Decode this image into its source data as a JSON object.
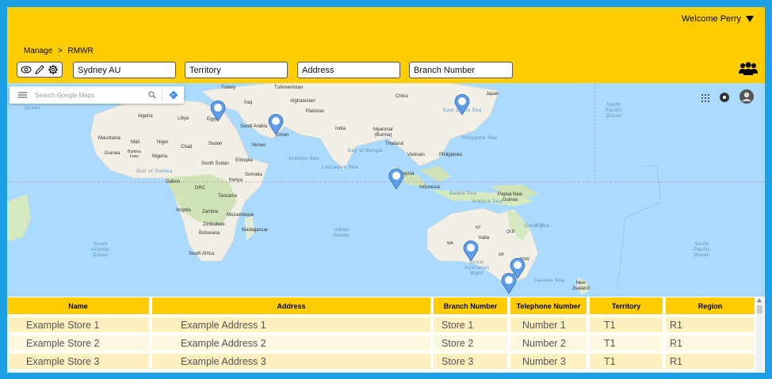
{
  "header": {
    "welcome": "Welcome Perry",
    "breadcrumb": {
      "root": "Manage",
      "sep": ">",
      "current": "RMWR"
    },
    "fields": {
      "location": "Sydney AU",
      "territory": "Territory",
      "address": "Address",
      "branch_number": "Branch Number"
    },
    "tools": [
      "eye-icon",
      "pencil-icon",
      "gear-icon"
    ],
    "right_icon": "people-group-icon",
    "accent": "#ffcc00"
  },
  "map": {
    "search_placeholder": "Search Google Maps",
    "labels": {
      "turkey": "Turkey",
      "turkmenistan": "Turkmenistan",
      "iraq": "Iraq",
      "afghanistan": "Afghanistan",
      "libya": "Libya",
      "algeria": "Algeria",
      "egypt": "Egypt",
      "pakistan": "Pakistan",
      "china": "China",
      "japan": "Japan",
      "saudi_arabia": "Saudi Arabia",
      "oman": "Oman",
      "india": "India",
      "myanmar": "Myanmar\n(Burma)",
      "thailand": "Thailand",
      "mauritania": "Mauritania",
      "mali": "Mali",
      "niger": "Niger",
      "chad": "Chad",
      "sudan": "Sudan",
      "yemen": "Yemen",
      "burkina": "Burkina\nFaso",
      "guinea": "Guinea",
      "nigeria": "Nigeria",
      "south_sudan": "South Sudan",
      "ethiopia": "Ethiopia",
      "somalia": "Somalia",
      "kenya": "Kenya",
      "gabon": "Gabon",
      "drc": "DRC",
      "tanzania": "Tanzania",
      "angola": "Angola",
      "zambia": "Zambia",
      "mozambique": "Mozambique",
      "zimbabwe": "Zimbabwe",
      "botswana": "Botswana",
      "madagascar": "Madagascar",
      "south_africa": "South Africa",
      "vietnam": "Vietnam",
      "philippines": "Philippines",
      "malaysia": "laysia",
      "indonesia": "Indonesia",
      "papua": "Papua New\nGuinea",
      "australia": "tralia",
      "new_zealand": "New\nZealand",
      "arabian_sea": "Arabian Sea",
      "bay_of_bengal": "Bay of Bengal",
      "east_china_sea": "East China Sea",
      "philippine_sea": "Philippine Sea",
      "laccadive_sea": "Laccadive Sea",
      "gulf_of_guinea": "Gulf of Guinea",
      "banda_sea": "Banda Sea",
      "arafura_sea": "Arafura Sea",
      "coral_sea": "Coral Sea",
      "fiji": "Fiji",
      "tasman_sea": "Tasman Sea",
      "great_bight": "Great\nAustralian\nBight",
      "ocean_n_pacific": "North\nPacific\nOcean",
      "ocean_s_pacific": "South\nPacific\nOcean",
      "ocean_indian": "Indian\nOcean",
      "ocean_s_atlantic": "South\nAtlantic\nOcean",
      "wa": "WA",
      "nt": "NT",
      "qld": "QLD",
      "nsw": "NSW",
      "vic": "VIC",
      "sa": "SA",
      "ocean": "Ocean"
    },
    "marker_count": 7
  },
  "table": {
    "headers": [
      "Name",
      "Address",
      "Branch Number",
      "Telephone Number",
      "Territory",
      "Region"
    ],
    "rows": [
      [
        "Example Store 1",
        "Example Address 1",
        "Store 1",
        "Number 1",
        "T1",
        "R1"
      ],
      [
        "Example Store 2",
        "Example Address 2",
        "Store 2",
        "Number 2",
        "T1",
        "R1"
      ],
      [
        "Example Store 3",
        "Example Address 3",
        "Store 3",
        "Number 3",
        "T1",
        "R1"
      ]
    ]
  }
}
